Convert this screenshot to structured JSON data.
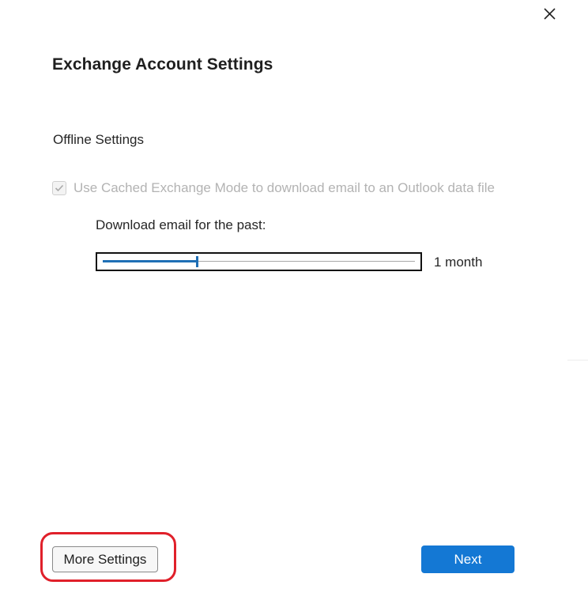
{
  "dialog": {
    "title": "Exchange Account Settings",
    "close_icon": "close-icon"
  },
  "offline": {
    "section_title": "Offline Settings",
    "cached_mode": {
      "label": "Use Cached Exchange Mode to download email to an Outlook data file",
      "checked": true,
      "disabled": true
    },
    "download": {
      "label": "Download email for the past:",
      "value_label": "1 month",
      "slider_fraction": 0.3
    }
  },
  "footer": {
    "more_settings_label": "More Settings",
    "next_label": "Next"
  },
  "colors": {
    "accent": "#1478d4",
    "slider_fill": "#1f6fb5",
    "highlight": "#e0202a"
  }
}
